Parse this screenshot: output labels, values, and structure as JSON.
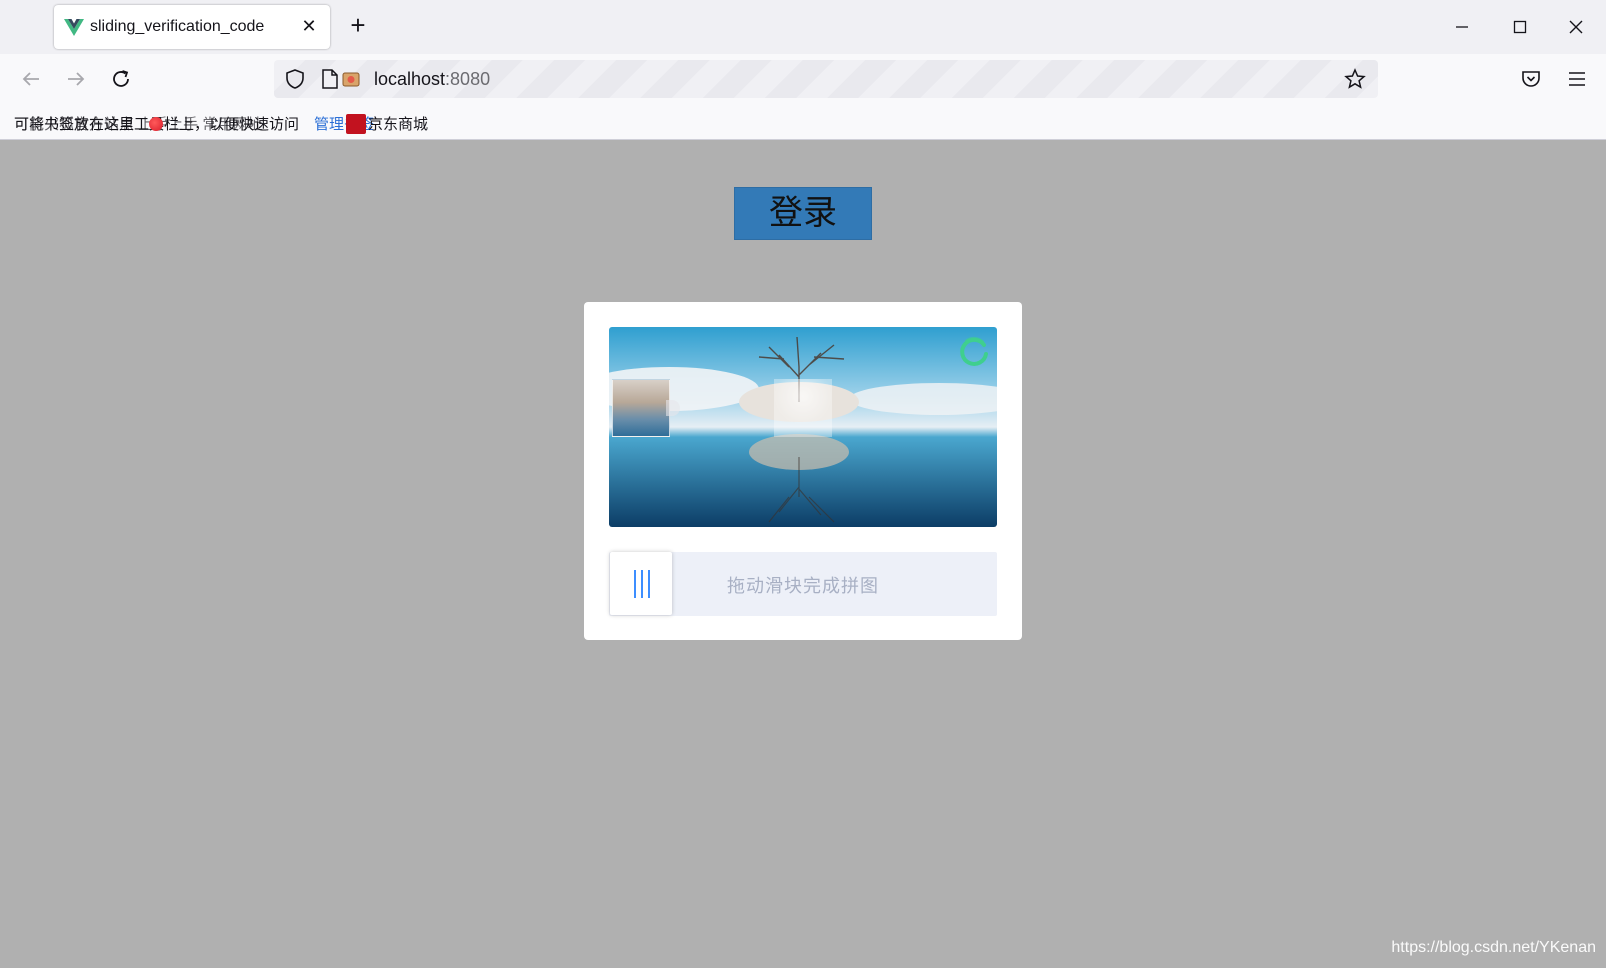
{
  "browser": {
    "tab_title": "sliding_verification_code",
    "url_host": "localhost",
    "url_port": ":8080",
    "bookmarks_text": "可将书签放在这里工具栏上，以便快速访问",
    "bookmarks_overlap": "可能火狐官方站点 上手上手 常用网址",
    "bookmarks_blue": "管理书签",
    "bookmark_jd": "京东商城"
  },
  "page": {
    "login_label": "登录",
    "slider_hint": "拖动滑块完成拼图"
  },
  "watermark": "https://blog.csdn.net/YKenan",
  "colors": {
    "page_bg": "#b0b0b0",
    "login_bg": "#337ab7",
    "slider_track": "#edf0f8",
    "handle_bars": "#3d8eff",
    "refresh_icon": "#3fcf8e"
  }
}
